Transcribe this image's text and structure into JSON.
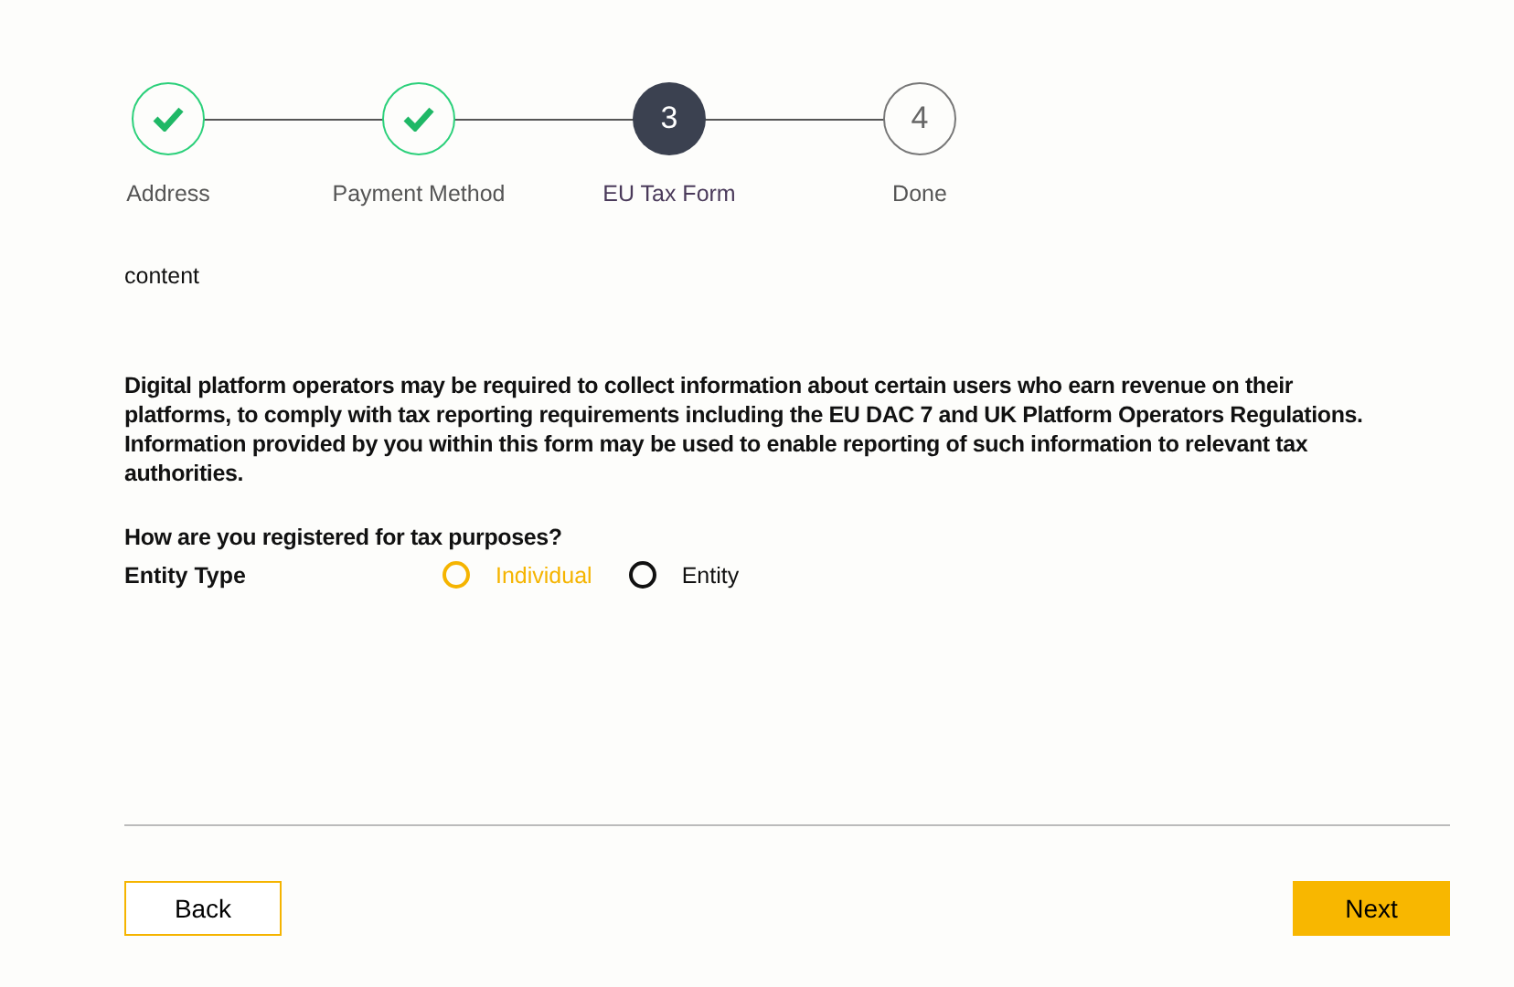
{
  "steps": [
    {
      "label": "Address",
      "completed": true,
      "current": false
    },
    {
      "label": "Payment Method",
      "completed": true,
      "current": false
    },
    {
      "label": "EU Tax Form",
      "number": "3",
      "completed": false,
      "current": true
    },
    {
      "label": "Done",
      "number": "4",
      "completed": false,
      "current": false
    }
  ],
  "content_label": "content",
  "notice": "Digital platform operators may be required to collect information about certain users who earn revenue on their platforms, to comply with tax reporting requirements including the EU DAC 7 and UK Platform Operators Regulations. Information provided by you within this form may be used to enable reporting of such information to relevant tax authorities.",
  "question": "How are you registered for tax purposes?",
  "field": {
    "label": "Entity Type",
    "options": [
      {
        "label": "Individual",
        "selected": false,
        "hovered": true
      },
      {
        "label": "Entity",
        "selected": false,
        "hovered": false
      }
    ]
  },
  "buttons": {
    "back": "Back",
    "next": "Next"
  }
}
